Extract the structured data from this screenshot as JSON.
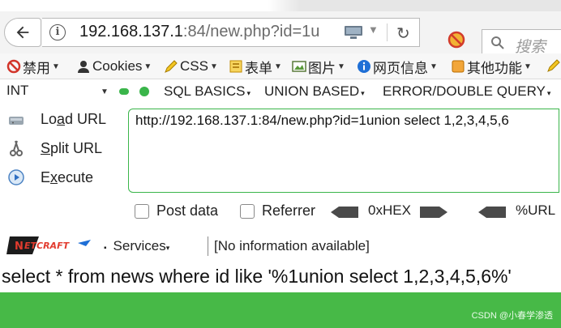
{
  "browser": {
    "url_host": "192.168.137.1",
    "url_rest": ":84/new.php?id=1u",
    "search_placeholder": "搜索"
  },
  "bookmarks": [
    {
      "label": "禁用",
      "icon": "block-icon"
    },
    {
      "label": "Cookies",
      "icon": "user-icon"
    },
    {
      "label": "CSS",
      "icon": "pencil-icon"
    },
    {
      "label": "表单",
      "icon": "form-icon"
    },
    {
      "label": "图片",
      "icon": "image-icon"
    },
    {
      "label": "网页信息",
      "icon": "info-icon"
    },
    {
      "label": "其他功能",
      "icon": "tool-icon"
    }
  ],
  "hackbar": {
    "type_select": "INT",
    "menus": [
      "SQL BASICS",
      "UNION BASED",
      "ERROR/DOUBLE QUERY"
    ],
    "actions": {
      "load_pre": "Lo",
      "load_ul": "a",
      "load_post": "d URL",
      "split_ul": "S",
      "split_post": "plit URL",
      "exec_pre": "E",
      "exec_ul": "x",
      "exec_post": "ecute"
    },
    "url_field": "http://192.168.137.1:84/new.php?id=1union select 1,2,3,4,5,6",
    "post_data_label": "Post data",
    "referrer_label": "Referrer",
    "hex_label": "0xHEX",
    "url_enc_label": "%URL",
    "services_label": "Services",
    "no_info": "[No information available]"
  },
  "page": {
    "query_text": "select * from news where id like '%1union select 1,2,3,4,5,6%'",
    "watermark": "CSDN @小春学渗透"
  },
  "colors": {
    "accent_green": "#3ab54a",
    "page_green": "#47b947"
  }
}
